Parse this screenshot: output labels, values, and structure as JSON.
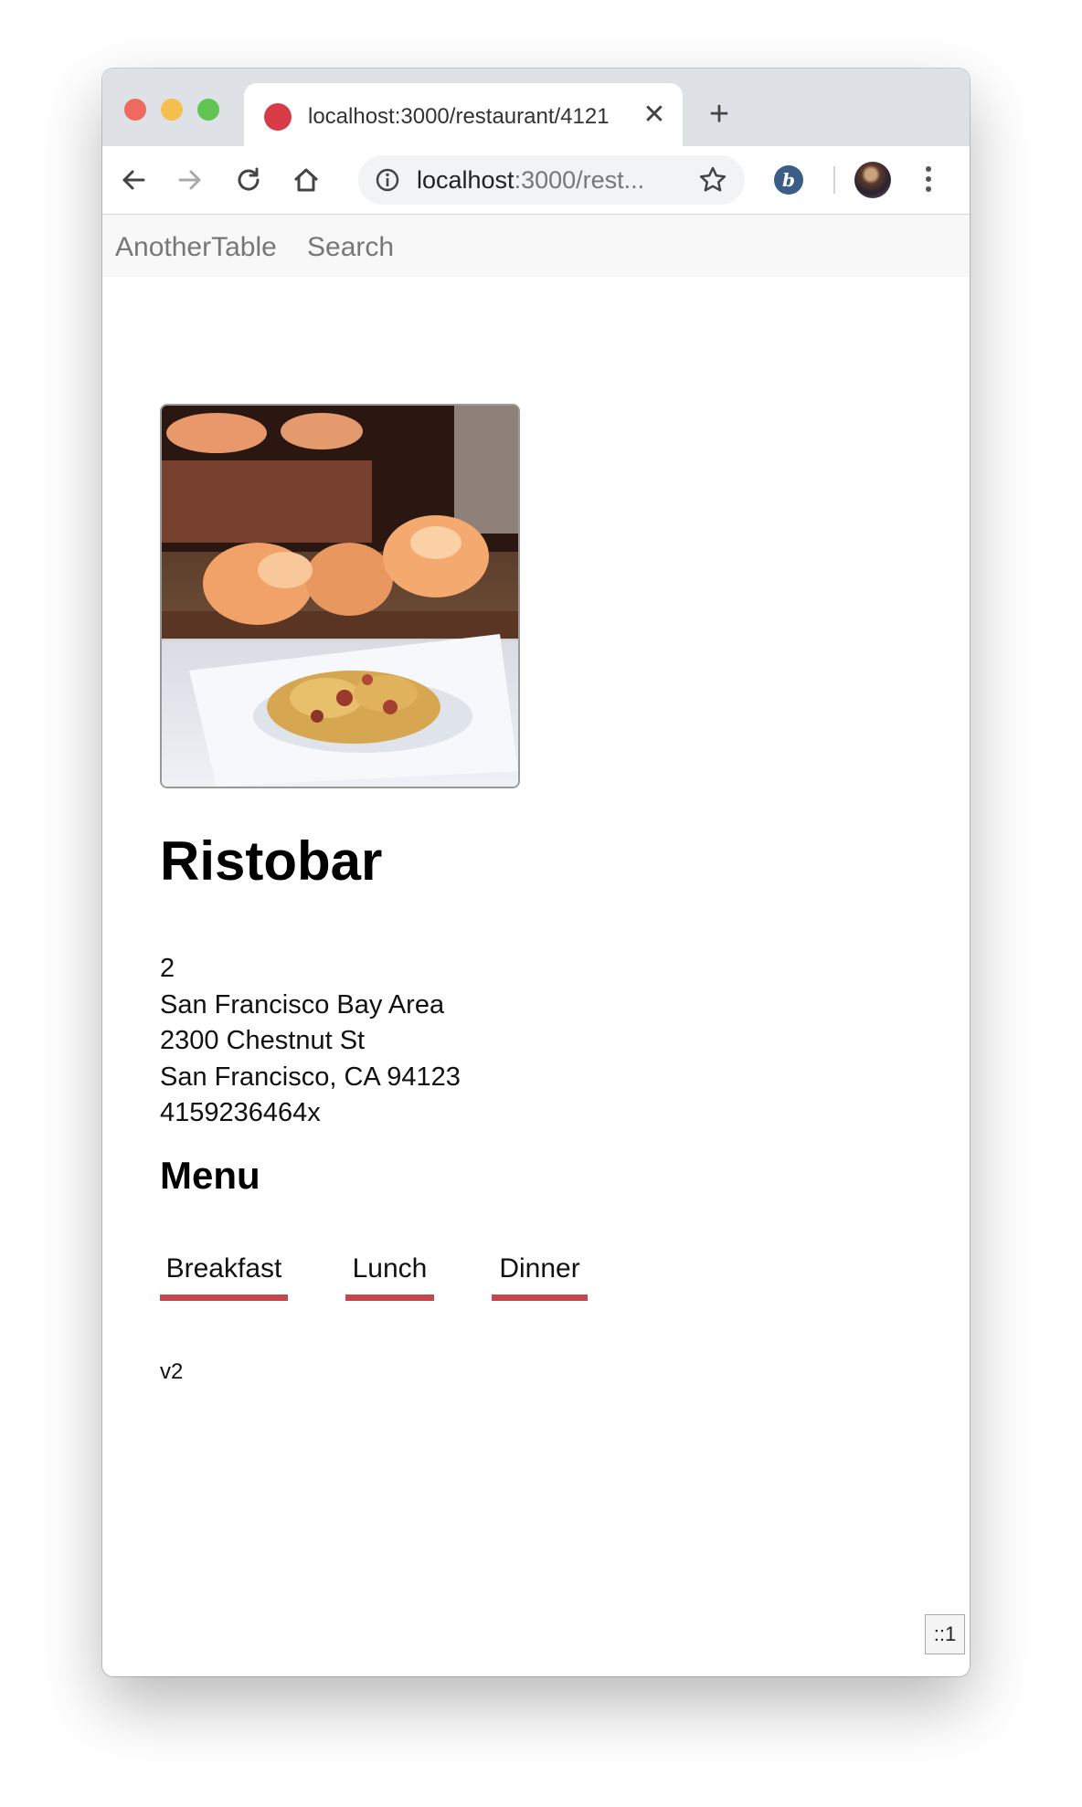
{
  "browser": {
    "tab": {
      "title": "localhost:3000/restaurant/4121",
      "close_glyph": "✕"
    },
    "new_tab_glyph": "+",
    "omnibox": {
      "host": "localhost",
      "rest": ":3000/rest..."
    },
    "extension_label": "b",
    "icons": [
      "back-icon",
      "forward-icon",
      "reload-icon",
      "home-icon",
      "info-icon",
      "star-icon",
      "profile-avatar",
      "menu-kebab-icon"
    ]
  },
  "navbar": {
    "brand": "AnotherTable",
    "search": "Search"
  },
  "restaurant": {
    "name": "Ristobar",
    "info_lines": [
      "2",
      "San Francisco Bay Area",
      "2300 Chestnut St",
      "San Francisco, CA 94123",
      "4159236464x"
    ]
  },
  "menu": {
    "heading": "Menu",
    "tabs": [
      "Breakfast",
      "Lunch",
      "Dinner"
    ],
    "tab_underline_color": "#c4474d"
  },
  "footer": {
    "version": "v2",
    "corner_badge": "::1"
  }
}
